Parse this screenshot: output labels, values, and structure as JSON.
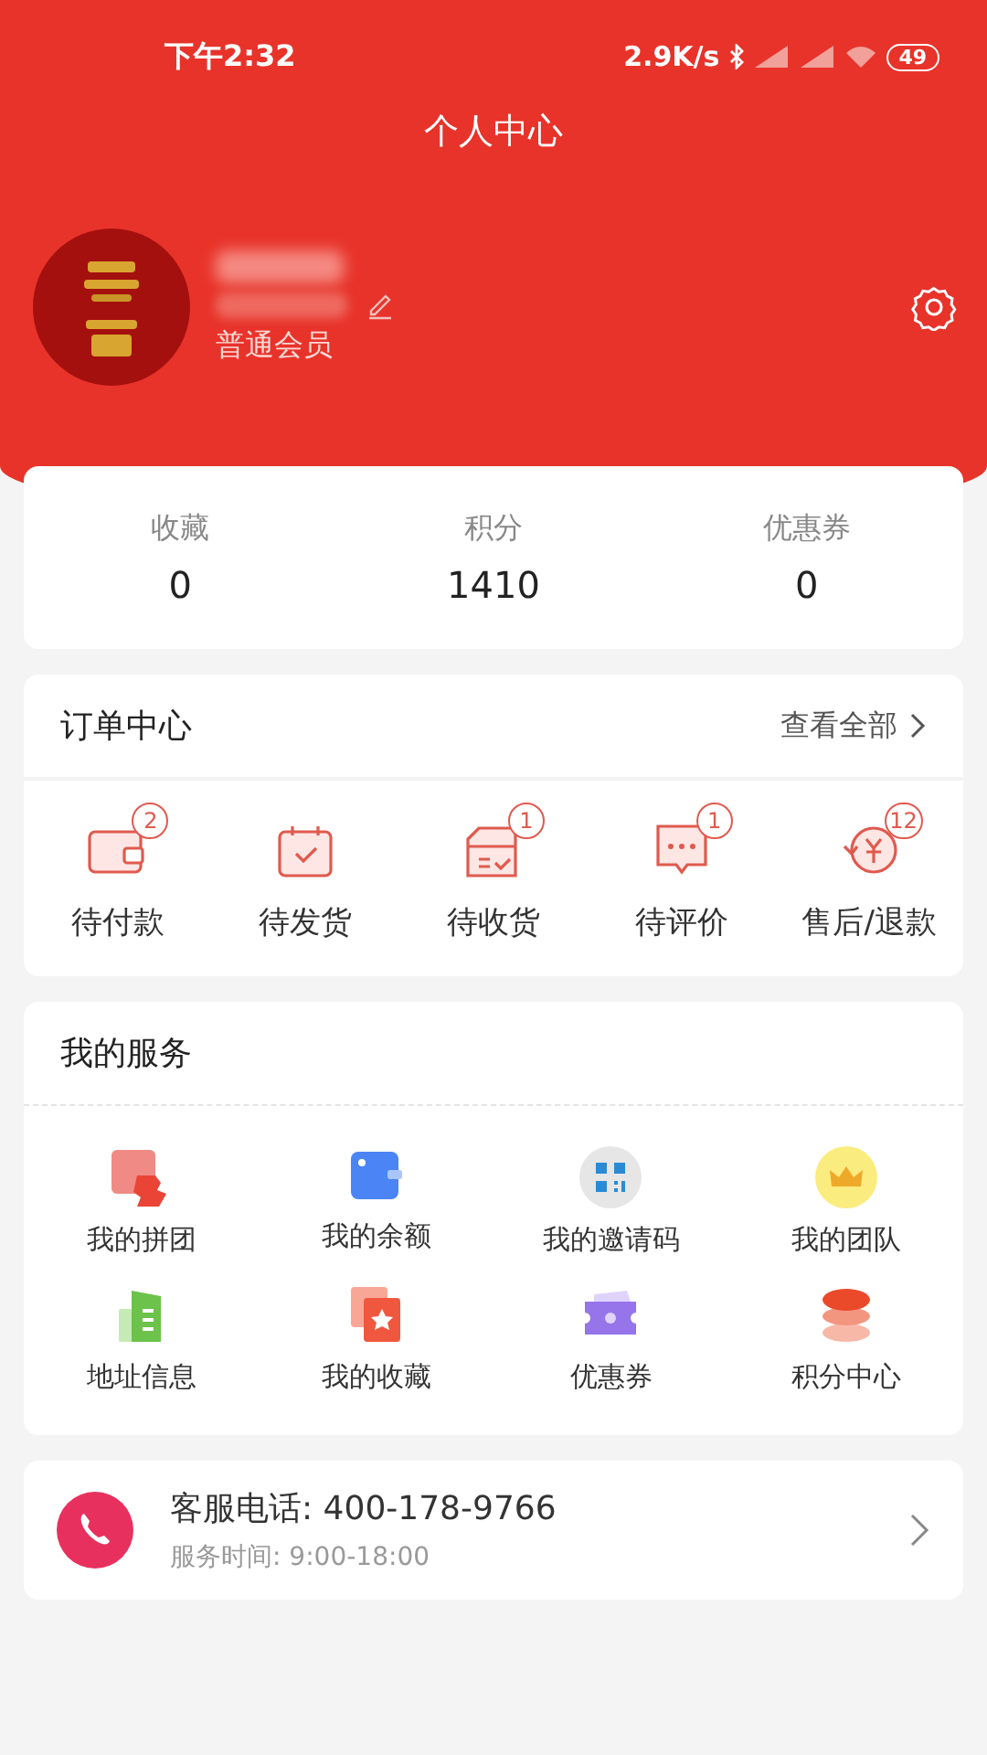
{
  "status_bar": {
    "time": "下午2:32",
    "speed": "2.9K/s",
    "battery": "49"
  },
  "header": {
    "title": "个人中心"
  },
  "profile": {
    "member_level": "普通会员"
  },
  "stats": [
    {
      "label": "收藏",
      "value": "0"
    },
    {
      "label": "积分",
      "value": "1410"
    },
    {
      "label": "优惠券",
      "value": "0"
    }
  ],
  "orders": {
    "title": "订单中心",
    "view_all": "查看全部",
    "items": [
      {
        "kind": "wallet",
        "label": "待付款",
        "badge": "2"
      },
      {
        "kind": "calendar",
        "label": "待发货"
      },
      {
        "kind": "box",
        "label": "待收货",
        "badge": "1"
      },
      {
        "kind": "chat",
        "label": "待评价",
        "badge": "1"
      },
      {
        "kind": "refund",
        "label": "售后/退款",
        "badge": "12"
      }
    ]
  },
  "services": {
    "title": "我的服务",
    "items": [
      {
        "kind": "puzzle",
        "label": "我的拼团"
      },
      {
        "kind": "balance",
        "label": "我的余额"
      },
      {
        "kind": "qr",
        "label": "我的邀请码"
      },
      {
        "kind": "crown",
        "label": "我的团队"
      },
      {
        "kind": "address",
        "label": "地址信息"
      },
      {
        "kind": "favorite",
        "label": "我的收藏"
      },
      {
        "kind": "coupon",
        "label": "优惠券"
      },
      {
        "kind": "points",
        "label": "积分中心"
      }
    ]
  },
  "support": {
    "phone": "客服电话: 400-178-9766",
    "hours": "服务时间: 9:00-18:00"
  }
}
